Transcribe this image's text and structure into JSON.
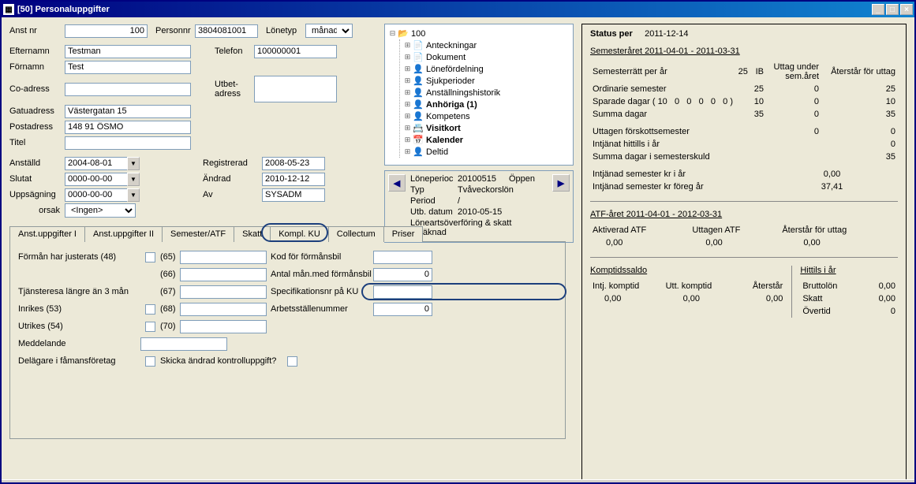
{
  "window": {
    "title": "[50]  Personaluppgifter"
  },
  "form": {
    "anst_nr_label": "Anst nr",
    "anst_nr": "100",
    "personnr_label": "Personnr",
    "personnr": "3804081001",
    "lonetyp_label": "Lönetyp",
    "lonetyp": "månad",
    "efternamn_label": "Efternamn",
    "efternamn": "Testman",
    "telefon_label": "Telefon",
    "telefon": "100000001",
    "fornamn_label": "Förnamn",
    "fornamn": "Test",
    "coadress_label": "Co-adress",
    "coadress": "",
    "utbet_label": "Utbet-\nadress",
    "utbet": "",
    "gatuadress_label": "Gatuadress",
    "gatuadress": "Västergatan 15",
    "postadress_label": "Postadress",
    "postadress": "148 91 ÖSMO",
    "titel_label": "Titel",
    "titel": "",
    "anstalld_label": "Anställd",
    "anstalld": "2004-08-01",
    "registrerad_label": "Registrerad",
    "registrerad": "2008-05-23",
    "slutat_label": "Slutat",
    "slutat": "0000-00-00",
    "andrad_label": "Ändrad",
    "andrad": "2010-12-12",
    "uppsagning_label": "Uppsägning",
    "uppsagning": "0000-00-00",
    "av_label": "Av",
    "av": "SYSADM",
    "orsak_label": "orsak",
    "orsak": "<Ingen>"
  },
  "tabs": {
    "t1": "Anst.uppgifter I",
    "t2": "Anst.uppgifter II",
    "t3": "Semester/ATF",
    "t4": "Skatt",
    "t5": "Kompl. KU",
    "t6": "Collectum",
    "t7": "Priser"
  },
  "ku": {
    "forman_label": "Förmån har justerats (48)",
    "tjansteresa_label": "Tjänsteresa längre än 3 mån",
    "inrikes_label": "Inrikes (53)",
    "utrikes_label": "Utrikes (54)",
    "meddelande_label": "Meddelande",
    "delagare_label": "Delägare i fåmansföretag",
    "skicka_label": "Skicka ändrad kontrolluppgift?",
    "n65": "(65)",
    "n66": "(66)",
    "n67": "(67)",
    "n68": "(68)",
    "n70": "(70)",
    "kod_formansbil_label": "Kod för förmånsbil",
    "antal_man_label": "Antal mån.med förmånsbil",
    "antal_man": "0",
    "specnr_label": "Specifikationsnr på KU",
    "arbetsstalle_label": "Arbetsställenummer",
    "arbetsstalle": "0"
  },
  "tree": {
    "root": "100",
    "items": [
      {
        "label": "Anteckningar",
        "icon": "📄",
        "bold": false
      },
      {
        "label": "Dokument",
        "icon": "📄",
        "bold": false
      },
      {
        "label": "Lönefördelning",
        "icon": "👤",
        "bold": false
      },
      {
        "label": "Sjukperioder",
        "icon": "👤",
        "bold": false
      },
      {
        "label": "Anställningshistorik",
        "icon": "👤",
        "bold": false
      },
      {
        "label": "Anhöriga (1)",
        "icon": "👤",
        "bold": true
      },
      {
        "label": "Kompetens",
        "icon": "👤",
        "bold": false
      },
      {
        "label": "Visitkort",
        "icon": "📇",
        "bold": true
      },
      {
        "label": "Kalender",
        "icon": "📅",
        "bold": true
      },
      {
        "label": "Deltid",
        "icon": "👤",
        "bold": false
      }
    ]
  },
  "period": {
    "lp_label": "Löneperioc",
    "lp_val": "20100515",
    "lp_status": "Öppen",
    "typ_label": "Typ",
    "typ_val": "Tvåveckorslön",
    "period_label": "Period",
    "period_val": "/",
    "utb_label": "Utb. datum",
    "utb_val": "2010-05-15",
    "footer": "Löneartsöverföring & skatt beräknad"
  },
  "status": {
    "header_label": "Status per",
    "header_date": "2011-12-14",
    "sem_title": "Semesteråret 2011-04-01 - 2011-03-31",
    "sem_lbl": "Semesterrätt per år",
    "sem_val": "25",
    "col_ib": "IB",
    "col_uttag": "Uttag under sem.året",
    "col_aterstar": "Återstår för uttag",
    "ord_lbl": "Ordinarie semester",
    "ord_ib": "25",
    "ord_ut": "0",
    "ord_at": "25",
    "spd_lbl": "Sparade dagar (",
    "spd_v1": "10",
    "spd_v2": "0",
    "spd_v3": "0",
    "spd_v4": "0",
    "spd_v5": "0",
    "spd_v6": "0 )",
    "spd_ib": "10",
    "spd_ut": "0",
    "spd_at": "10",
    "sum_lbl": "Summa dagar",
    "sum_ib": "35",
    "sum_ut": "0",
    "sum_at": "35",
    "utt_lbl": "Uttagen förskottsemester",
    "utt_ut": "0",
    "utt_at": "0",
    "intj_lbl": "Intjänat hittills i år",
    "intj_at": "0",
    "skuld_lbl": "Summa dagar i semesterskuld",
    "skuld_at": "35",
    "kr_i_ar_lbl": "Intjänad semester kr i år",
    "kr_i_ar": "0,00",
    "kr_f_ar_lbl": "Intjänad semester kr föreg år",
    "kr_f_ar": "37,41",
    "atf_title": "ATF-året 2011-04-01 - 2012-03-31",
    "atf_akt_lbl": "Aktiverad ATF",
    "atf_akt": "0,00",
    "atf_utt_lbl": "Uttagen ATF",
    "atf_utt": "0,00",
    "atf_at_lbl": "Återstår för uttag",
    "atf_at": "0,00",
    "komp_title": "Komptidssaldo",
    "komp_int_lbl": "Intj. komptid",
    "komp_int": "0,00",
    "komp_utt_lbl": "Utt. komptid",
    "komp_utt": "0,00",
    "komp_at_lbl": "Återstår",
    "komp_at": "0,00",
    "hitt_title": "Hittils i år",
    "brutto_lbl": "Bruttolön",
    "brutto": "0,00",
    "skatt_lbl": "Skatt",
    "skatt": "0,00",
    "overtid_lbl": "Övertid",
    "overtid": "0"
  }
}
